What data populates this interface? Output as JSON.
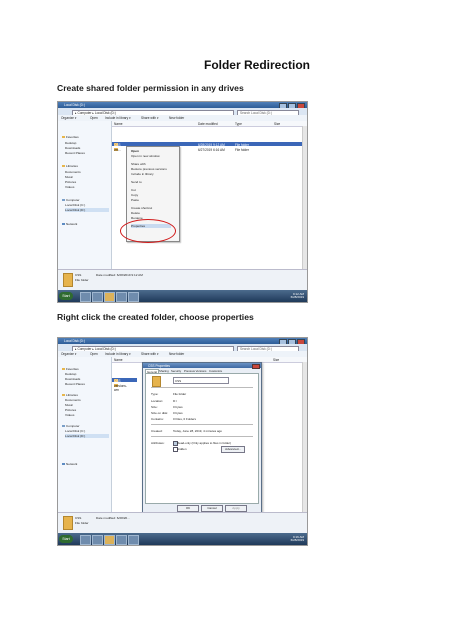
{
  "doc": {
    "title": "Folder Redirection",
    "caption1": "Create shared folder permission in any drives",
    "caption2": "Right click the created folder, choose properties"
  },
  "shot1": {
    "window_title": "Local Disk (D:)",
    "address": "▸ Computer ▸ Local Disk (D:)",
    "search_placeholder": "Search Local Disk (D:)",
    "toolbar": [
      "Organize ▾",
      "Open",
      "Include in library ▾",
      "Share with ▾",
      "New folder"
    ],
    "columns": [
      "Name",
      "Date modified",
      "Type",
      "Size"
    ],
    "rows": [
      {
        "name": "CSS",
        "date": "6/28/2019 9:12 AM",
        "type": "File folder",
        "highlight": true
      },
      {
        "name": "vm...",
        "date": "6/27/2019 6:16 AM",
        "type": "File folder",
        "highlight": false
      }
    ],
    "nav": [
      "Favorites",
      "Desktop",
      "Downloads",
      "Recent Places",
      "Libraries",
      "Documents",
      "Music",
      "Pictures",
      "Videos",
      "Computer",
      "Local Disk (C:)",
      "Local Disk (D:)",
      "Network"
    ],
    "menu": [
      "Open",
      "Open in new window",
      "Share with",
      "Restore previous versions",
      "Include in library",
      "Send to",
      "Cut",
      "Copy",
      "Paste",
      "Create shortcut",
      "Delete",
      "Rename",
      "Properties"
    ],
    "details_name": "CSS",
    "details_date": "Date modified: 6/28/2019 9:12 AM",
    "details_type": "File folder",
    "clock_time": "9:12 AM",
    "clock_date": "6/28/2019",
    "start_label": "Start"
  },
  "shot2": {
    "window_title": "Local Disk (D:)",
    "address": "▸ Computer ▸ Local Disk (D:)",
    "search_placeholder": "Search Local Disk (D:)",
    "toolbar": [
      "Organize ▾",
      "Open",
      "Include in library ▾",
      "Share with ▾",
      "New folder"
    ],
    "columns": [
      "Name",
      "Size"
    ],
    "rows": [
      {
        "name": "CSS",
        "highlight": true
      },
      {
        "name": "versions-wm",
        "highlight": false
      }
    ],
    "nav": [
      "Favorites",
      "Desktop",
      "Downloads",
      "Recent Places",
      "Libraries",
      "Documents",
      "Music",
      "Pictures",
      "Videos",
      "Computer",
      "Local Disk (C:)",
      "Local Disk (D:)",
      "Network"
    ],
    "dialog": {
      "title": "CSS Properties",
      "tabs": [
        "General",
        "Sharing",
        "Security",
        "Previous Versions",
        "Customize"
      ],
      "name_value": "CSS",
      "fields": [
        {
          "label": "Type:",
          "value": "File folder"
        },
        {
          "label": "Location:",
          "value": "D:\\"
        },
        {
          "label": "Size:",
          "value": "0 bytes"
        },
        {
          "label": "Size on disk:",
          "value": "0 bytes"
        },
        {
          "label": "Contains:",
          "value": "0 Files, 0 Folders"
        },
        {
          "label": "Created:",
          "value": "Today, June 28, 2019, 4 minutes ago"
        }
      ],
      "attributes_label": "Attributes:",
      "readonly_label": "Read-only (Only applies to files in folder)",
      "hidden_label": "Hidden",
      "advanced_label": "Advanced...",
      "ok": "OK",
      "cancel": "Cancel",
      "apply": "Apply"
    },
    "details_name": "CSS",
    "details_date": "Date modified: 6/28/20...",
    "details_type": "File folder",
    "clock_time": "9:16 AM",
    "clock_date": "6/28/2019",
    "start_label": "Start"
  }
}
